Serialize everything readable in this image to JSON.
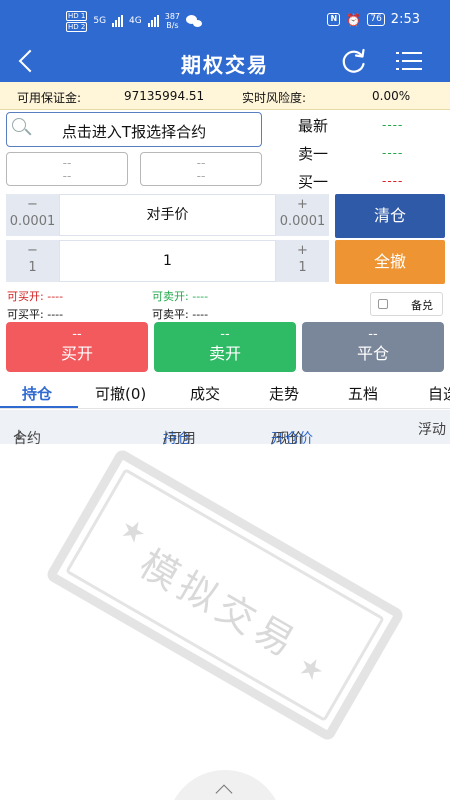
{
  "status_bar": {
    "hd_1": "HD 1",
    "hd_2": "HD 2",
    "net_1": "5G",
    "net_2": "4G",
    "speed_value": "387",
    "speed_unit": "B/s",
    "nfc": "N",
    "alarm": "⏰",
    "battery": "76",
    "time": "2:53"
  },
  "navbar": {
    "title": "期权交易",
    "back_icon": "chevron-left-icon",
    "refresh_icon": "refresh-icon",
    "menu_icon": "list-menu-icon"
  },
  "margin_bar": {
    "available_margin_label": "可用保证金:",
    "available_margin_value": "97135994.51",
    "risk_label": "实时风险度:",
    "risk_value": "0.00%"
  },
  "contract": {
    "search_text": "点击进入T报选择合约",
    "box_left": [
      "--",
      "--"
    ],
    "box_right": [
      "--",
      "--"
    ]
  },
  "quotes": [
    {
      "label": "最新",
      "value": "----",
      "color": "#22a74a"
    },
    {
      "label": "卖一",
      "value": "----",
      "color": "#22a74a"
    },
    {
      "label": "买一",
      "value": "----",
      "color": "#e02020"
    }
  ],
  "price_stepper": {
    "minus_label": "−",
    "minus_step": "0.0001",
    "value": "对手价",
    "plus_label": "+",
    "plus_step": "0.0001"
  },
  "qty_stepper": {
    "minus_label": "−",
    "minus_step": "1",
    "value": "1",
    "plus_label": "+",
    "plus_step": "1"
  },
  "side_buttons": {
    "clear": {
      "label": "清仓",
      "color": "#2f5aa8"
    },
    "cancel_all": {
      "label": "全撤",
      "color": "#ee9432"
    }
  },
  "availability": {
    "buy_open_label": "可买开:",
    "buy_open_value": "----",
    "sell_open_label": "可卖开:",
    "sell_open_value": "----",
    "buy_close_label": "可买平:",
    "buy_close_value": "----",
    "sell_close_label": "可卖平:",
    "sell_close_value": "----",
    "covered_label": "备兑"
  },
  "actions": [
    {
      "top": "--",
      "label": "买开",
      "color": "#f25a5e"
    },
    {
      "top": "--",
      "label": "卖开",
      "color": "#2fba65"
    },
    {
      "top": "--",
      "label": "平仓",
      "color": "#7a8699"
    }
  ],
  "tabs": [
    "持仓",
    "可撤(0)",
    "成交",
    "走势",
    "五档",
    "自选"
  ],
  "table_header": {
    "contract": "合约",
    "sort_arrow": "↓",
    "position": "持仓",
    "available": "/可用",
    "open_price": "开仓价",
    "current_price": "/现价",
    "floating": "浮动"
  },
  "watermark": {
    "text": "模拟交易"
  }
}
